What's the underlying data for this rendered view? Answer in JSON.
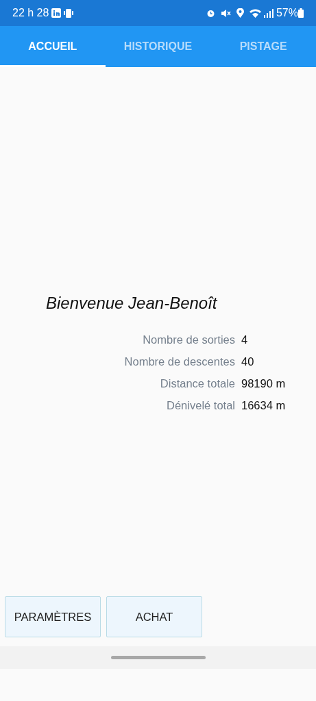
{
  "status_bar": {
    "time": "22 h 28",
    "battery": "57%"
  },
  "tabs": [
    {
      "label": "ACCUEIL",
      "selected": true
    },
    {
      "label": "HISTORIQUE",
      "selected": false
    },
    {
      "label": "PISTAGE",
      "selected": false
    }
  ],
  "welcome": "Bienvenue Jean-Benoît",
  "stats": [
    {
      "label": "Nombre de sorties",
      "value": "4"
    },
    {
      "label": "Nombre de descentes",
      "value": "40"
    },
    {
      "label": "Distance totale",
      "value": "98190 m"
    },
    {
      "label": "Dénivelé total",
      "value": "16634 m"
    }
  ],
  "buttons": [
    "PARAMÈTRES",
    "ACHAT"
  ]
}
